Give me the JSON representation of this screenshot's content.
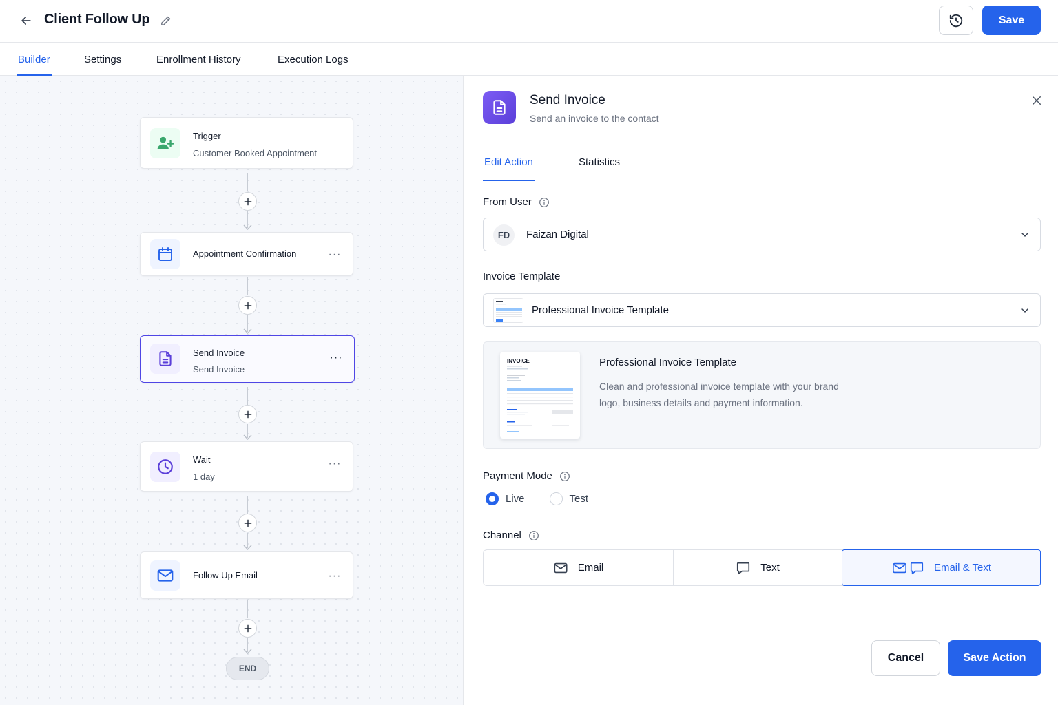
{
  "header": {
    "title": "Client Follow Up",
    "save_label": "Save"
  },
  "tabs": [
    {
      "label": "Builder",
      "active": true
    },
    {
      "label": "Settings",
      "active": false
    },
    {
      "label": "Enrollment History",
      "active": false
    },
    {
      "label": "Execution Logs",
      "active": false
    }
  ],
  "workflow": {
    "nodes": [
      {
        "title": "Trigger",
        "subtitle": "Customer Booked Appointment",
        "icon": "user-plus-icon",
        "color": "#16a34a"
      },
      {
        "title": "Appointment Confirmation",
        "subtitle": "",
        "icon": "calendar-icon",
        "color": "#2563eb"
      },
      {
        "title": "Send Invoice",
        "subtitle": "Send Invoice",
        "icon": "document-icon",
        "color": "#5b3fd9",
        "selected": true
      },
      {
        "title": "Wait",
        "subtitle": "1 day",
        "icon": "clock-icon",
        "color": "#5b3fd9"
      },
      {
        "title": "Follow Up Email",
        "subtitle": "",
        "icon": "mail-icon",
        "color": "#2563eb"
      }
    ],
    "end_label": "END"
  },
  "panel": {
    "title": "Send Invoice",
    "subtitle": "Send an invoice to the contact",
    "tabs": [
      {
        "label": "Edit Action",
        "active": true
      },
      {
        "label": "Statistics",
        "active": false
      }
    ],
    "from_user": {
      "label": "From User",
      "initials": "FD",
      "value": "Faizan Digital"
    },
    "invoice_template": {
      "label": "Invoice Template",
      "value": "Professional Invoice Template"
    },
    "preview": {
      "doc_heading": "INVOICE",
      "title": "Professional Invoice Template",
      "description": "Clean and professional invoice template with your brand logo, business details and payment information."
    },
    "payment_mode": {
      "label": "Payment Mode",
      "options": [
        {
          "label": "Live",
          "selected": true
        },
        {
          "label": "Test",
          "selected": false
        }
      ]
    },
    "channel": {
      "label": "Channel",
      "options": [
        {
          "label": "Email",
          "selected": false
        },
        {
          "label": "Text",
          "selected": false
        },
        {
          "label": "Email & Text",
          "selected": true
        }
      ]
    },
    "cancel_label": "Cancel",
    "save_action_label": "Save Action"
  },
  "colors": {
    "primary": "#2563eb",
    "accent_purple": "#5b3fd9",
    "trigger_green": "#16a34a"
  }
}
